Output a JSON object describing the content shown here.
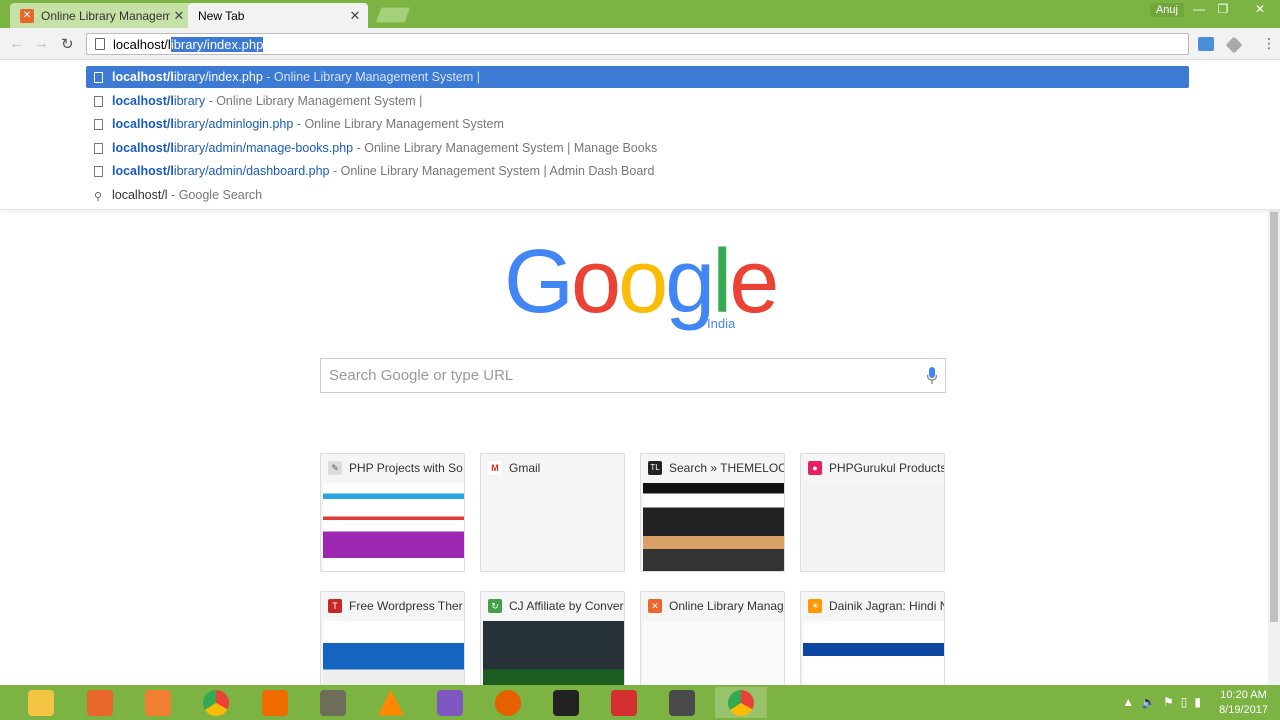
{
  "tabs": [
    {
      "title": "Online Library Managem",
      "favicon": "xampp-icon"
    },
    {
      "title": "New Tab"
    }
  ],
  "user_name": "Anuj",
  "address_bar": {
    "prefix": "localhost/l",
    "selected": "ibrary/index.php"
  },
  "suggestions": [
    {
      "url_bold": "localhost/l",
      "url_rest": "ibrary/index.php",
      "desc": "- Online Library Management System |"
    },
    {
      "url_bold": "localhost/l",
      "url_rest": "ibrary",
      "desc": "- Online Library Management System |"
    },
    {
      "url_bold": "localhost/l",
      "url_rest": "ibrary/adminlogin.php",
      "desc": "- Online Library Management System"
    },
    {
      "url_bold": "localhost/l",
      "url_rest": "ibrary/admin/manage-books.php",
      "desc": "- Online Library Management System | Manage Books"
    },
    {
      "url_bold": "localhost/l",
      "url_rest": "ibrary/admin/dashboard.php",
      "desc": "- Online Library Management System | Admin Dash Board"
    },
    {
      "url_bold": "",
      "url_rest": "localhost/l",
      "desc": "- Google Search"
    }
  ],
  "logo": {
    "letters": [
      "G",
      "o",
      "o",
      "g",
      "l",
      "e"
    ],
    "region": "India"
  },
  "search": {
    "placeholder": "Search Google or type URL"
  },
  "tiles": [
    {
      "title": "PHP Projects with So"
    },
    {
      "title": "Gmail"
    },
    {
      "title": "Search » THEMELOC"
    },
    {
      "title": "PHPGurukul Products"
    },
    {
      "title": "Free Wordpress Ther"
    },
    {
      "title": "CJ Affiliate by Conver"
    },
    {
      "title": "Online Library Manag"
    },
    {
      "title": "Dainik Jagran: Hindi N"
    }
  ],
  "clock": {
    "time": "10:20 AM",
    "date": "8/19/2017"
  },
  "colors": {
    "chrome_green": "#7cb342",
    "selection_blue": "#3d7ad4"
  }
}
